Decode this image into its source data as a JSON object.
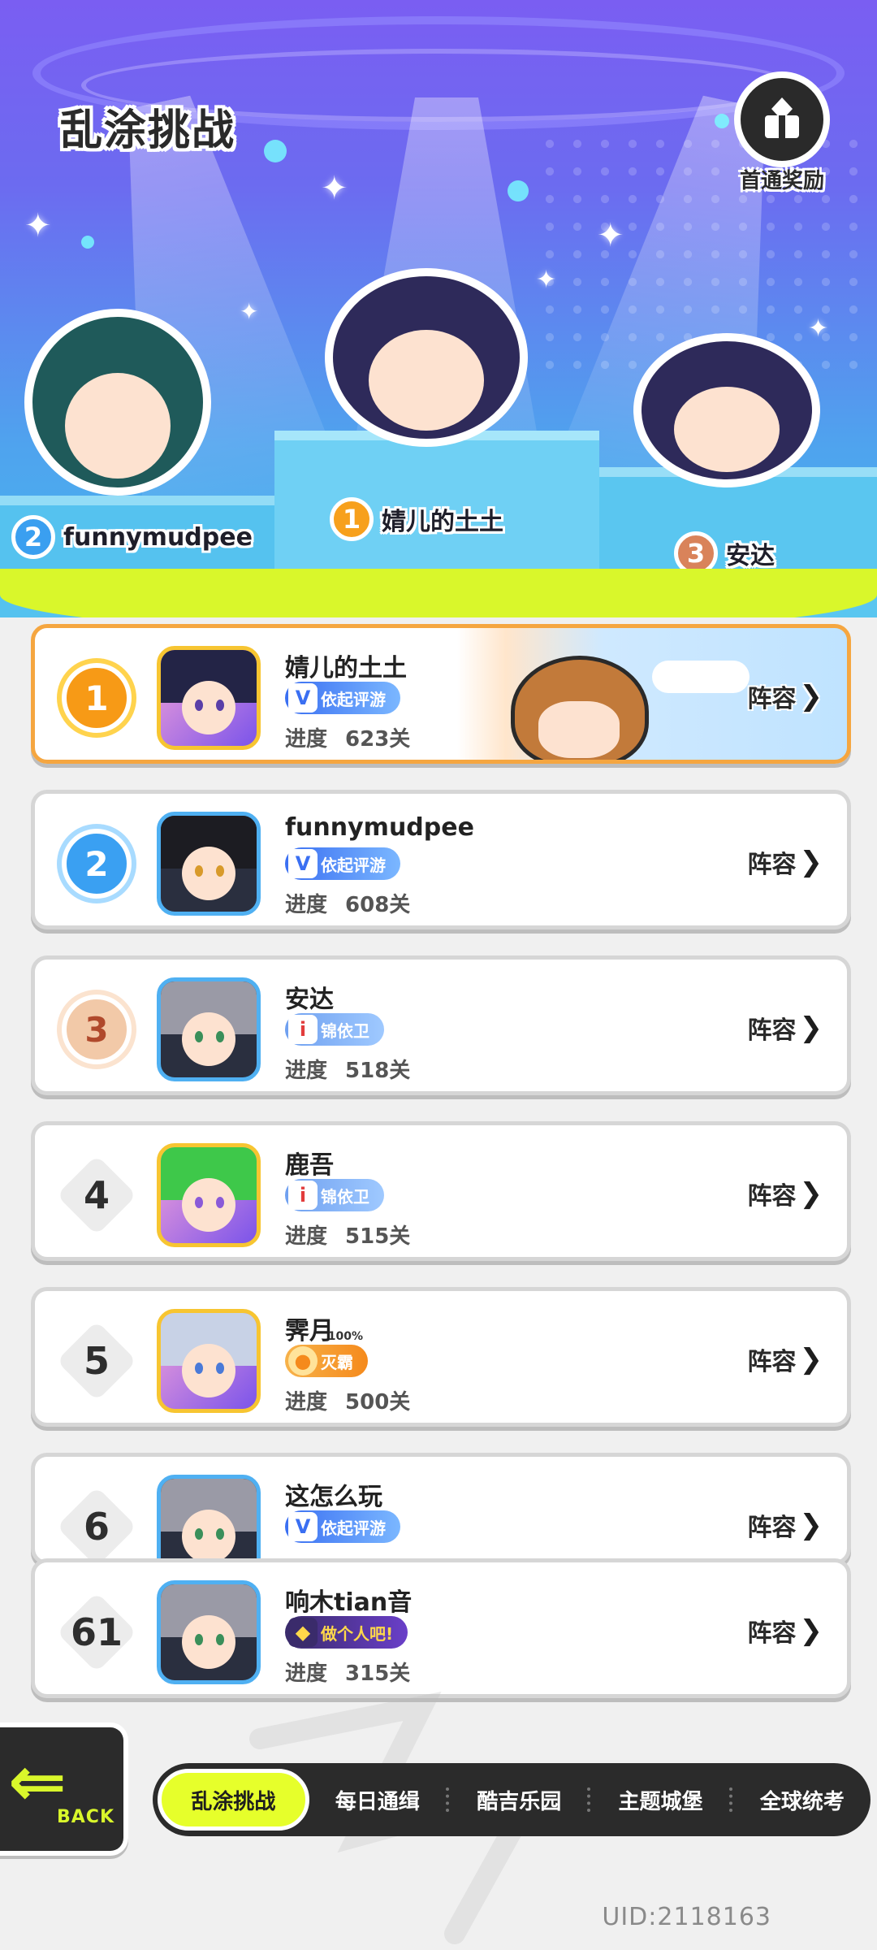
{
  "header": {
    "title": "乱涂挑战",
    "reward_label": "首通奖励"
  },
  "podium": [
    {
      "rank": "1",
      "name": "婧儿的土土"
    },
    {
      "rank": "2",
      "name": "funnymudpee"
    },
    {
      "rank": "3",
      "name": "安达"
    }
  ],
  "ranking": {
    "progress_label": "进度",
    "lineup_label": "阵容",
    "rows": [
      {
        "rank": "1",
        "name": "婧儿的土土",
        "tag": "依起评游",
        "tag_icon": "V",
        "progress": "623关"
      },
      {
        "rank": "2",
        "name": "funnymudpee",
        "tag": "依起评游",
        "tag_icon": "V",
        "progress": "608关"
      },
      {
        "rank": "3",
        "name": "安达",
        "tag": "锦依卫",
        "tag_icon": "i",
        "progress": "518关"
      },
      {
        "rank": "4",
        "name": "鹿吾",
        "tag": "锦依卫",
        "tag_icon": "i",
        "progress": "515关"
      },
      {
        "rank": "5",
        "name": "霁月",
        "tag": "灭霸",
        "tag_icon": "●",
        "badge_note": "100%",
        "progress": "500关"
      },
      {
        "rank": "6",
        "name": "这怎么玩",
        "tag": "依起评游",
        "tag_icon": "V",
        "progress": ""
      }
    ],
    "self": {
      "rank": "61",
      "name": "响木tian音",
      "tag": "做个人吧!",
      "tag_icon": "◆",
      "progress": "315关"
    }
  },
  "back": {
    "label": "BACK"
  },
  "tabs": [
    "乱涂挑战",
    "每日通缉",
    "酷吉乐园",
    "主题城堡",
    "全球统考"
  ],
  "uid": "UID:2118163",
  "colors": {
    "accent": "#e6ff2b",
    "dark": "#2b2b2b",
    "gold": "#f79a16",
    "silver": "#3aa0f2",
    "bronze": "#f2c9a8"
  }
}
